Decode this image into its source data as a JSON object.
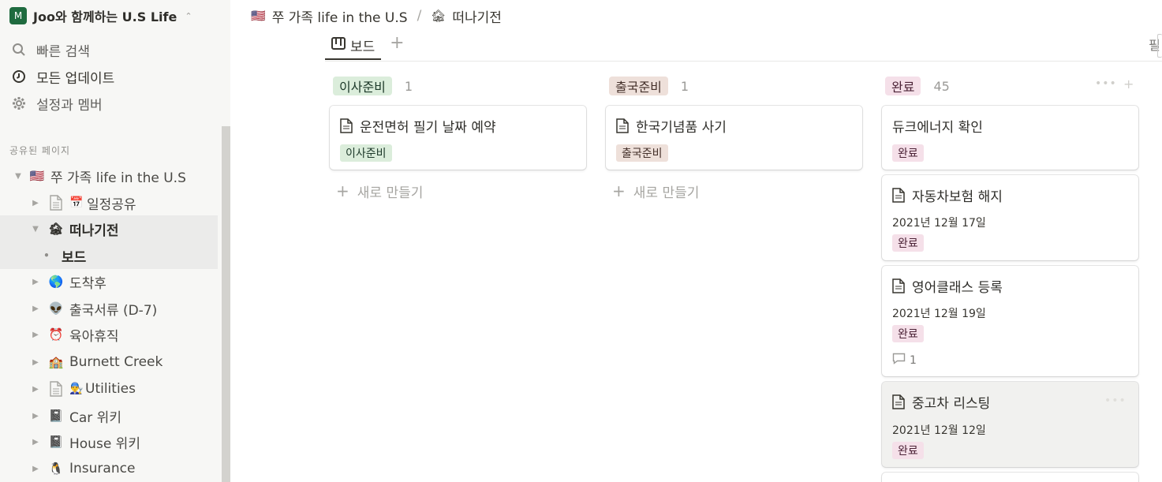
{
  "workspace": {
    "initial": "M",
    "name": "Joo와 함께하는 U.S Life"
  },
  "sidebar": {
    "quick": [
      {
        "label": "빠른 검색",
        "icon": "search-icon"
      },
      {
        "label": "모든 업데이트",
        "icon": "clock-icon"
      },
      {
        "label": "설정과 멤버",
        "icon": "gear-icon"
      }
    ],
    "section_label": "공유된 페이지",
    "tree": [
      {
        "label": "쭈 가족 life in the U.S",
        "emoji": "🇺🇸",
        "icon": "us-flag-icon",
        "caret": "▼"
      },
      {
        "label": "일정공유",
        "emoji": "📄📅",
        "icon": "calendar-page-icon",
        "caret": "▶"
      },
      {
        "label": "떠나기전",
        "emoji": "🏚",
        "icon": "house-icon",
        "caret": "▼"
      },
      {
        "label": "보드",
        "emoji": "•",
        "icon": "bullet-icon",
        "caret": ""
      },
      {
        "label": "도착후",
        "emoji": "🌎",
        "icon": "globe-icon",
        "caret": "▶"
      },
      {
        "label": "출국서류 (D-7)",
        "emoji": "👽",
        "icon": "alien-icon",
        "caret": "▶"
      },
      {
        "label": "육아휴직",
        "emoji": "⏰",
        "icon": "alarm-clock-icon",
        "caret": "▶"
      },
      {
        "label": "Burnett Creek",
        "emoji": "🏫",
        "icon": "school-icon",
        "caret": "▶"
      },
      {
        "label": "Utilities",
        "emoji": "📄👨‍🔧",
        "icon": "mechanic-page-icon",
        "caret": "▶"
      },
      {
        "label": "Car 위키",
        "emoji": "📓",
        "icon": "notebook-icon",
        "caret": "▶"
      },
      {
        "label": "House 위키",
        "emoji": "📓",
        "icon": "notebook-icon",
        "caret": "▶"
      },
      {
        "label": "Insurance",
        "emoji": "🐧",
        "icon": "penguin-icon",
        "caret": "▶"
      }
    ]
  },
  "breadcrumb": {
    "parent": {
      "label": "쭈 가족 life in the U.S",
      "emoji": "🇺🇸"
    },
    "separator": "/",
    "current": {
      "label": "떠나기전",
      "emoji": "🏚"
    }
  },
  "tabs": {
    "board_label": "보드",
    "add": "+",
    "filter_label": "필"
  },
  "board": {
    "new_label": "새로 만들기",
    "columns": [
      {
        "label": "이사준비",
        "count": "1",
        "color": "#dbeddb",
        "cards": [
          {
            "title": "운전면허 필기 날짜 예약",
            "date": "",
            "tag": "이사준비",
            "comments": ""
          }
        ]
      },
      {
        "label": "출국준비",
        "count": "1",
        "color": "#eee0da",
        "cards": [
          {
            "title": "한국기념품 사기",
            "date": "",
            "tag": "출국준비",
            "comments": ""
          }
        ]
      },
      {
        "label": "완료",
        "count": "45",
        "color": "#f5e0e9",
        "cards": [
          {
            "title": "듀크에너지 확인",
            "date": "",
            "tag": "완료",
            "comments": ""
          },
          {
            "title": "자동차보험 해지",
            "date": "2021년 12월 17일",
            "tag": "완료",
            "comments": ""
          },
          {
            "title": "영어클래스 등록",
            "date": "2021년 12월 19일",
            "tag": "완료",
            "comments": "1"
          },
          {
            "title": "중고차 리스팅",
            "date": "2021년 12월 12일",
            "tag": "완료",
            "comments": ""
          }
        ]
      }
    ]
  }
}
